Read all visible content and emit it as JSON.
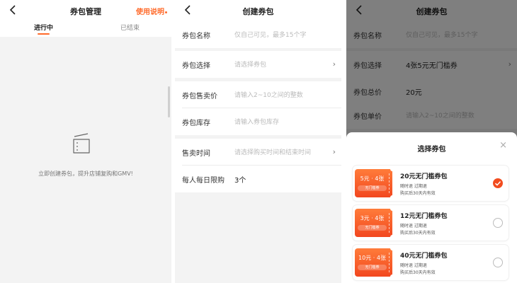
{
  "panel1": {
    "title": "券包管理",
    "help_link": "使用说明",
    "tabs": [
      {
        "label": "进行中",
        "active": true
      },
      {
        "label": "已结束",
        "active": false
      }
    ],
    "empty_text": "立即创建券包，提升店铺复购和GMV!"
  },
  "panel2": {
    "title": "创建券包",
    "rows": [
      {
        "label": "券包名称",
        "value": "仅自己可见，最多15个字",
        "placeholder": true,
        "chevron": false
      },
      {
        "label": "券包选择",
        "value": "请选择券包",
        "placeholder": true,
        "chevron": true
      },
      {
        "label": "券包售卖价",
        "value": "请输入2~10之间的整数",
        "placeholder": true,
        "chevron": false
      },
      {
        "label": "券包库存",
        "value": "请输入券包库存",
        "placeholder": true,
        "chevron": false
      },
      {
        "label": "售卖时间",
        "value": "请选择购买时间和结束时间",
        "placeholder": true,
        "chevron": true
      },
      {
        "label": "每人每日限购",
        "value": "3个",
        "placeholder": false,
        "chevron": false
      }
    ],
    "chevron_glyph": "›"
  },
  "panel3": {
    "title": "创建券包",
    "rows": [
      {
        "label": "券包名称",
        "value": "仅自己可见，最多15个字"
      },
      {
        "label": "券包选择",
        "value": "4张5元无门槛券"
      },
      {
        "label": "券包总价",
        "value": "20元"
      },
      {
        "label": "券包单价",
        "value": "请输入2~10之间的整数"
      }
    ],
    "sheet": {
      "title": "选择券包",
      "close_glyph": "×",
      "options": [
        {
          "coupon": "5元 · 4张",
          "coupon_sub": "无门槛券",
          "name": "20元无门槛券包",
          "tag": "随时退 过期退",
          "note": "购买后30天内有效",
          "selected": true
        },
        {
          "coupon": "3元 · 4张",
          "coupon_sub": "无门槛券",
          "name": "12元无门槛券包",
          "tag": "随时退 过期退",
          "note": "购买后30天内有效",
          "selected": false
        },
        {
          "coupon": "10元 · 4张",
          "coupon_sub": "无门槛券",
          "name": "40元无门槛券包",
          "tag": "随时退 过期退",
          "note": "购买后30天内有效",
          "selected": false
        }
      ]
    }
  },
  "colors": {
    "accent": "#ff6a2a",
    "coupon_gradient_top": "#ff7c3a",
    "coupon_gradient_bottom": "#f2471f",
    "page_bg": "#f3f3f3"
  },
  "icons": [
    "back-arrow-icon",
    "ticket-icon",
    "chevron-right-icon",
    "close-icon",
    "check-icon"
  ]
}
